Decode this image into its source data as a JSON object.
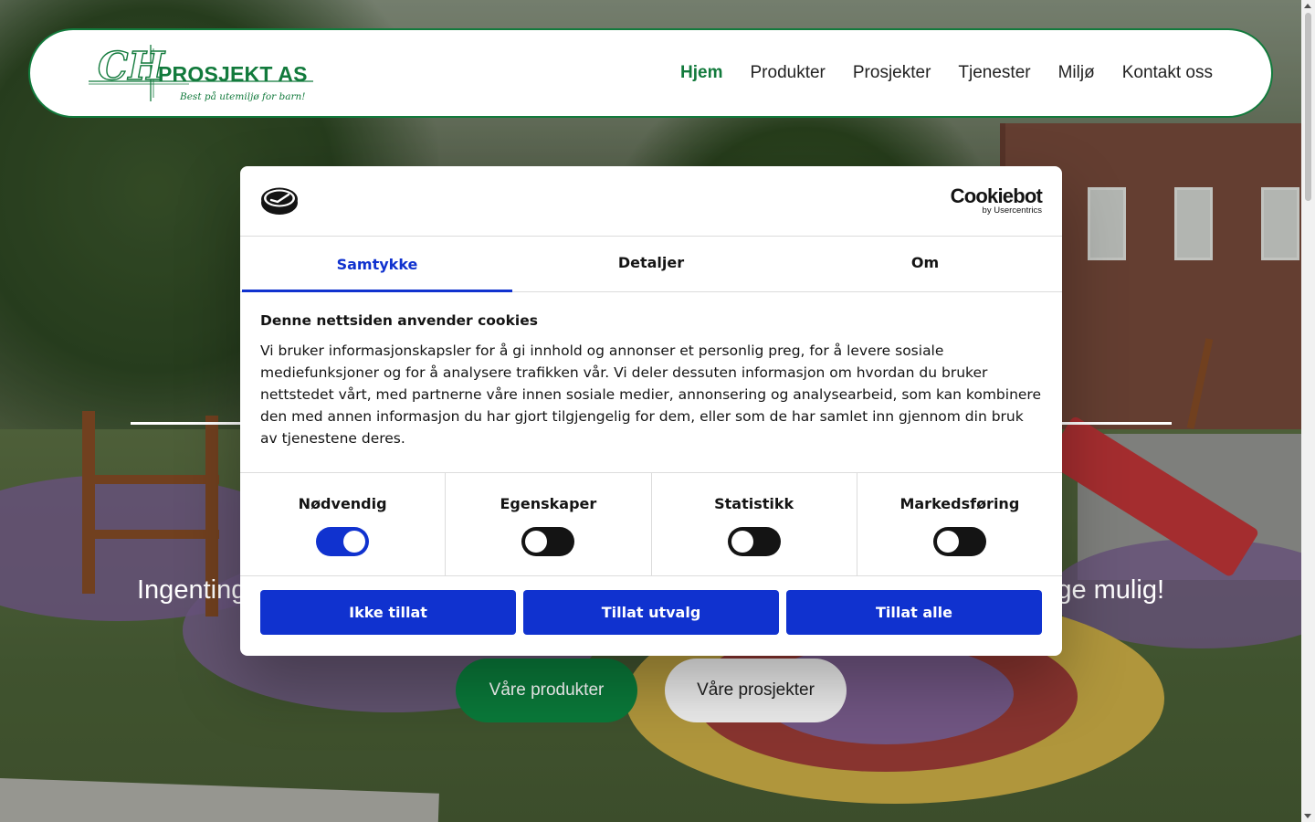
{
  "header": {
    "logo_text": "CH PROSJEKT AS",
    "logo_slogan": "Best på utemiljø for barn!",
    "nav": [
      {
        "label": "Hjem",
        "active": true
      },
      {
        "label": "Produkter",
        "active": false
      },
      {
        "label": "Prosjekter",
        "active": false
      },
      {
        "label": "Tjenester",
        "active": false
      },
      {
        "label": "Miljø",
        "active": false
      },
      {
        "label": "Kontakt oss",
        "active": false
      }
    ]
  },
  "hero": {
    "tagline_visible_left": "Ingenting",
    "tagline_visible_right": "ge mulig!",
    "buttons": {
      "products": "Våre produkter",
      "projects": "Våre prosjekter"
    }
  },
  "cookie_dialog": {
    "brand": {
      "name": "Cookiebot",
      "byline": "by Usercentrics"
    },
    "tabs": [
      {
        "label": "Samtykke",
        "active": true
      },
      {
        "label": "Detaljer",
        "active": false
      },
      {
        "label": "Om",
        "active": false
      }
    ],
    "title": "Denne nettsiden anvender cookies",
    "text": "Vi bruker informasjonskapsler for å gi innhold og annonser et personlig preg, for å levere sosiale mediefunksjoner og for å analysere trafikken vår. Vi deler dessuten informasjon om hvordan du bruker nettstedet vårt, med partnerne våre innen sosiale medier, annonsering og analysearbeid, som kan kombinere den med annen informasjon du har gjort tilgjengelig for dem, eller som de har samlet inn gjennom din bruk av tjenestene deres.",
    "toggles": [
      {
        "label": "Nødvendig",
        "on": true
      },
      {
        "label": "Egenskaper",
        "on": false
      },
      {
        "label": "Statistikk",
        "on": false
      },
      {
        "label": "Markedsføring",
        "on": false
      }
    ],
    "actions": {
      "deny": "Ikke tillat",
      "allow_selection": "Tillat utvalg",
      "allow_all": "Tillat alle"
    }
  },
  "colors": {
    "brand_green": "#127a3c",
    "cookiebot_blue": "#1032cf",
    "button_green": "#0a7a3a"
  }
}
